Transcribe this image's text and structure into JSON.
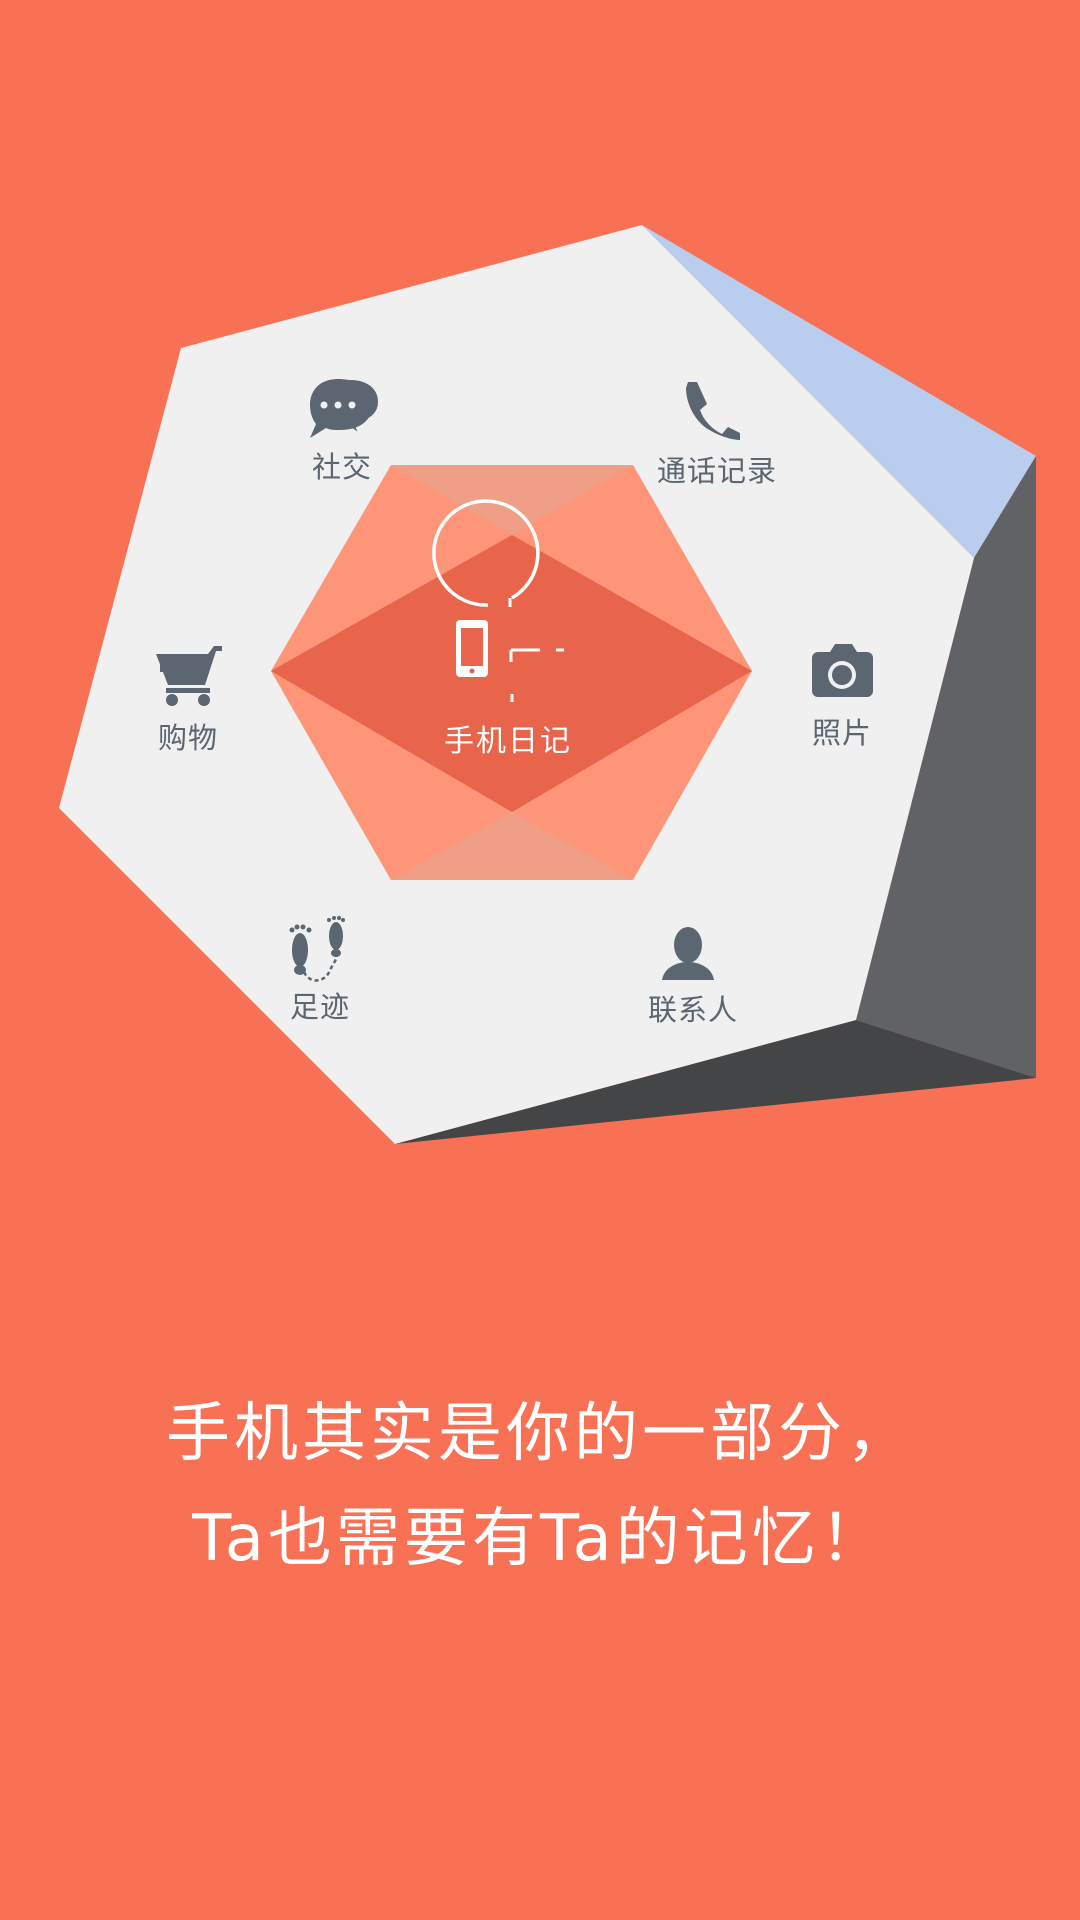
{
  "intro_screen": {
    "center_hub": {
      "label": "手机日记",
      "icon": "phone-clock-icon"
    },
    "features": [
      {
        "id": "social",
        "label": "社交",
        "icon": "chat-bubbles-icon"
      },
      {
        "id": "call-log",
        "label": "通话记录",
        "icon": "phone-handset-icon"
      },
      {
        "id": "shopping",
        "label": "购物",
        "icon": "shopping-cart-icon"
      },
      {
        "id": "photos",
        "label": "照片",
        "icon": "camera-icon"
      },
      {
        "id": "footprints",
        "label": "足迹",
        "icon": "footprints-icon"
      },
      {
        "id": "contacts",
        "label": "联系人",
        "icon": "person-icon"
      }
    ],
    "tagline": {
      "line1": "手机其实是你的一部分，",
      "line2": "Ta也需要有Ta的记忆！"
    },
    "colors": {
      "background": "#f87155",
      "panel": "#f0f0f0",
      "icon": "#5b6671",
      "hub_dark": "#e8644a",
      "hub_light": "#fe9478",
      "accent_blue": "#b9cdee",
      "shadow_gray": "#606265",
      "shadow_dark": "#434547"
    }
  }
}
